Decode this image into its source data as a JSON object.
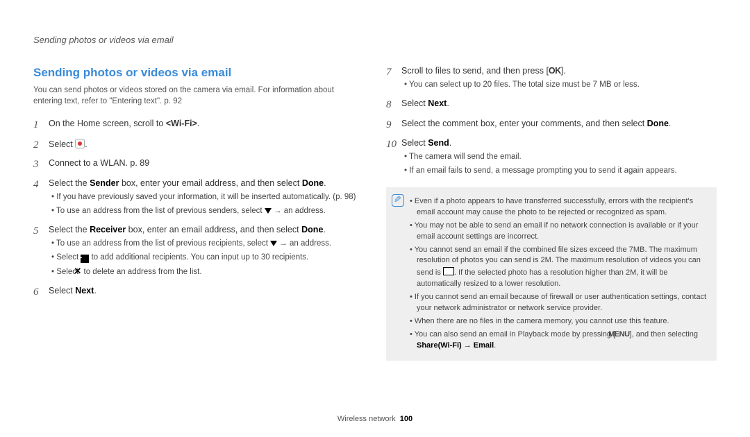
{
  "header": "Sending photos or videos via email",
  "section_title": "Sending photos or videos via email",
  "intro": "You can send photos or videos stored on the camera via email. For information about entering text, refer to \"Entering text\". p. 92",
  "left_steps": {
    "s1": {
      "num": "1",
      "text_a": "On the Home screen, scroll to ",
      "wifi": "<Wi-Fi>",
      "text_b": "."
    },
    "s2": {
      "num": "2",
      "text": "Select ",
      "dot": "."
    },
    "s3": {
      "num": "3",
      "text": "Connect to a WLAN. p. 89"
    },
    "s4": {
      "num": "4",
      "text_a": "Select the ",
      "sender": "Sender",
      "text_b": " box, enter your email address, and then select ",
      "done": "Done",
      "text_c": ".",
      "sub1": "If you have previously saved your information, it will be inserted automatically. (p. 98)",
      "sub2_a": "To use an address from the list of previous senders, select ",
      "sub2_b": " → an address."
    },
    "s5": {
      "num": "5",
      "text_a": "Select the ",
      "receiver": "Receiver",
      "text_b": " box, enter an email address, and then select ",
      "done": "Done",
      "text_c": ".",
      "sub1_a": "To use an address from the list of previous recipients, select ",
      "sub1_b": " → an address.",
      "sub2_a": "Select ",
      "sub2_b": " to add additional recipients. You can input up to 30 recipients.",
      "sub3_a": "Select ",
      "sub3_b": " to delete an address from the list."
    },
    "s6": {
      "num": "6",
      "text": "Select ",
      "next": "Next",
      "dot": "."
    }
  },
  "right_steps": {
    "s7": {
      "num": "7",
      "text_a": "Scroll to files to send, and then press [",
      "ok": "OK",
      "text_b": "].",
      "sub1": "You can select up to 20 files. The total size must be 7 MB or less."
    },
    "s8": {
      "num": "8",
      "text": "Select ",
      "next": "Next",
      "dot": "."
    },
    "s9": {
      "num": "9",
      "text_a": "Select the comment box, enter your comments, and then select ",
      "done": "Done",
      "text_b": "."
    },
    "s10": {
      "num": "10",
      "text": "Select ",
      "send": "Send",
      "dot": ".",
      "sub1": "The camera will send the email.",
      "sub2": "If an email fails to send, a message prompting you to send it again appears."
    }
  },
  "notes": {
    "n1": "Even if a photo appears to have transferred successfully, errors with the recipient's email account may cause the photo to be rejected or recognized as spam.",
    "n2": "You may not be able to send an email if no network connection is available or if your email account settings are incorrect.",
    "n3_a": "You cannot send an email if the combined file sizes exceed the 7MB. The maximum resolution of photos you can send is 2M. The maximum resolution of videos you can send is ",
    "n3_b": ". If the selected photo has a resolution higher than 2M, it will be automatically resized to a lower resolution.",
    "n4": "If you cannot send an email because of firewall or user authentication settings, contact your network administrator or network service provider.",
    "n5": "When there are no files in the camera memory, you cannot use this feature.",
    "n6_a": "You can also send an email in Playback mode by pressing [",
    "n6_menu": "MENU",
    "n6_b": "], and then selecting ",
    "n6_path": "Share(Wi-Fi) → Email",
    "n6_c": "."
  },
  "footer": {
    "label": "Wireless network",
    "page": "100"
  }
}
